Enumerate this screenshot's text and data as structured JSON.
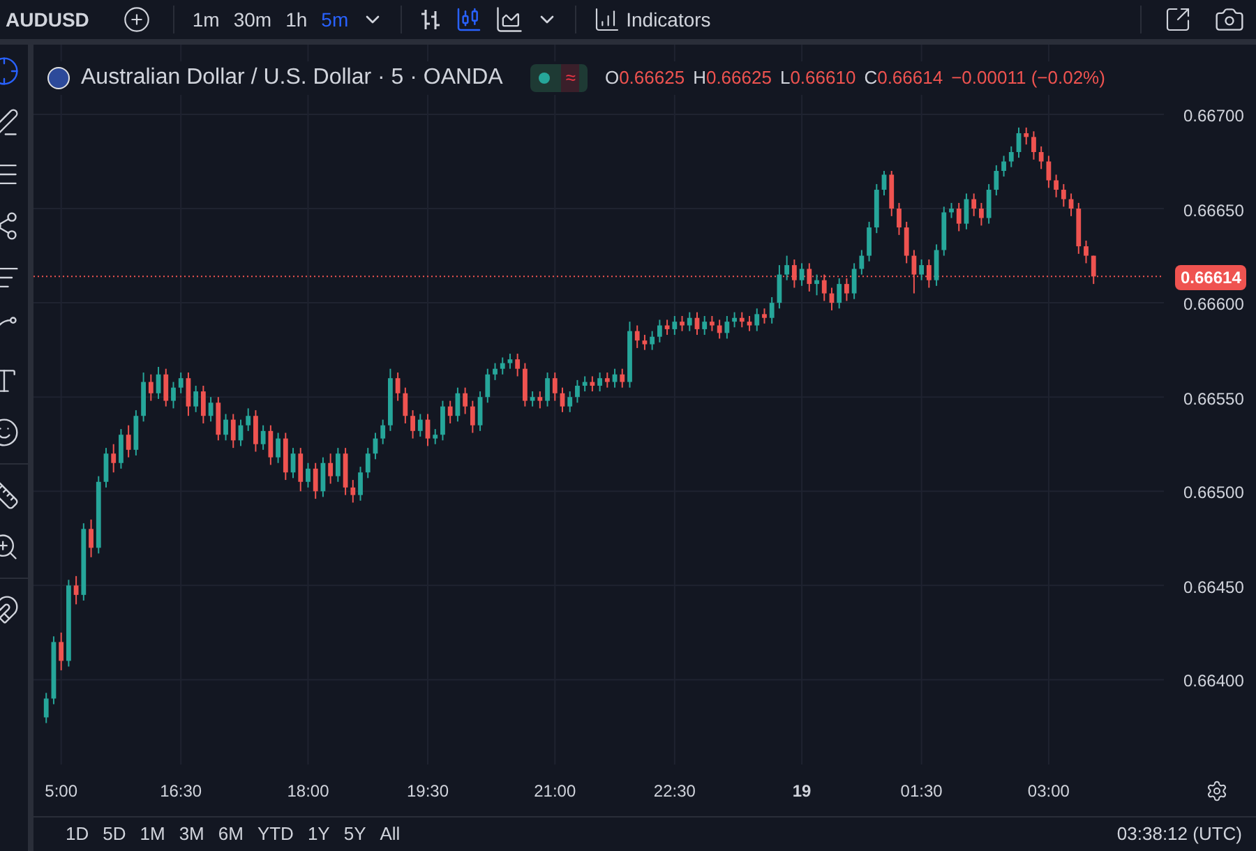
{
  "toolbar": {
    "symbol": "AUDUSD",
    "intervals": [
      {
        "label": "1m",
        "selected": false
      },
      {
        "label": "30m",
        "selected": false
      },
      {
        "label": "1h",
        "selected": false
      },
      {
        "label": "5m",
        "selected": true
      }
    ],
    "indicators": "Indicators"
  },
  "legend": {
    "title": "Australian Dollar / U.S. Dollar · 5 · OANDA",
    "badge": "≈",
    "ohlc": [
      {
        "key": "O",
        "value": "0.66625"
      },
      {
        "key": "H",
        "value": "0.66625"
      },
      {
        "key": "L",
        "value": "0.66610"
      },
      {
        "key": "C",
        "value": "0.66614"
      }
    ],
    "change": "−0.00011 (−0.02%)"
  },
  "chart": {
    "chart_data": {
      "type": "candlestick",
      "categories": [
        null,
        null,
        "5:00",
        null,
        null,
        null,
        null,
        null,
        null,
        null,
        null,
        null,
        null,
        null,
        null,
        null,
        null,
        null,
        "16:30",
        null,
        null,
        null,
        null,
        null,
        null,
        null,
        null,
        null,
        null,
        null,
        null,
        null,
        null,
        null,
        null,
        "18:00",
        null,
        null,
        null,
        null,
        null,
        null,
        null,
        null,
        null,
        null,
        null,
        null,
        null,
        null,
        null,
        "19:30",
        null,
        null,
        null,
        null,
        null,
        null,
        null,
        null,
        null,
        null,
        null,
        null,
        null,
        null,
        null,
        null,
        "21:00",
        null,
        null,
        null,
        null,
        null,
        null,
        null,
        null,
        null,
        null,
        null,
        null,
        null,
        null,
        null,
        "22:30",
        null,
        null,
        null,
        null,
        null,
        null,
        null,
        null,
        null,
        null,
        null,
        null,
        null,
        null,
        null,
        null,
        "19",
        null,
        null,
        null,
        null,
        null,
        null,
        null,
        null,
        null,
        null,
        null,
        null,
        null,
        null,
        null,
        "01:30",
        null,
        null,
        null,
        null,
        null,
        null,
        null,
        null,
        null,
        null,
        null,
        null,
        null,
        null,
        null,
        null,
        "03:00",
        null,
        null,
        null,
        null,
        null,
        null
      ],
      "ylim": [
        0.66355,
        0.66737
      ],
      "grid": true,
      "ref_lines": [
        {
          "axis": "y",
          "value": 0.66614,
          "label": "0.66614",
          "color": "#ef5350"
        }
      ],
      "ohlc": [
        [
          0.6638,
          0.66393,
          0.66377,
          0.6639
        ],
        [
          0.6639,
          0.66423,
          0.66387,
          0.6642
        ],
        [
          0.6642,
          0.66425,
          0.66405,
          0.6641
        ],
        [
          0.6641,
          0.66453,
          0.66407,
          0.6645
        ],
        [
          0.6645,
          0.66455,
          0.6644,
          0.66445
        ],
        [
          0.66445,
          0.66483,
          0.66442,
          0.6648
        ],
        [
          0.6648,
          0.66485,
          0.66465,
          0.6647
        ],
        [
          0.6647,
          0.66508,
          0.66467,
          0.66505
        ],
        [
          0.66505,
          0.66523,
          0.66502,
          0.6652
        ],
        [
          0.6652,
          0.66525,
          0.6651,
          0.66515
        ],
        [
          0.66515,
          0.66533,
          0.66512,
          0.6653
        ],
        [
          0.6653,
          0.66535,
          0.66518,
          0.66522
        ],
        [
          0.66522,
          0.66543,
          0.66519,
          0.6654
        ],
        [
          0.6654,
          0.66563,
          0.66537,
          0.66558
        ],
        [
          0.66558,
          0.66562,
          0.66548,
          0.66552
        ],
        [
          0.66552,
          0.66566,
          0.66549,
          0.66562
        ],
        [
          0.66562,
          0.66565,
          0.66545,
          0.66548
        ],
        [
          0.66548,
          0.66558,
          0.66544,
          0.66555
        ],
        [
          0.66555,
          0.66563,
          0.66552,
          0.6656
        ],
        [
          0.6656,
          0.66563,
          0.6654,
          0.66545
        ],
        [
          0.66545,
          0.66556,
          0.66542,
          0.66553
        ],
        [
          0.66553,
          0.66556,
          0.66536,
          0.6654
        ],
        [
          0.6654,
          0.6655,
          0.66537,
          0.66547
        ],
        [
          0.66547,
          0.6655,
          0.66527,
          0.6653
        ],
        [
          0.6653,
          0.66541,
          0.66527,
          0.66538
        ],
        [
          0.66538,
          0.66541,
          0.66523,
          0.66527
        ],
        [
          0.66527,
          0.66538,
          0.66524,
          0.66535
        ],
        [
          0.66535,
          0.66544,
          0.66532,
          0.6654
        ],
        [
          0.6654,
          0.66543,
          0.66521,
          0.66525
        ],
        [
          0.66525,
          0.66535,
          0.66522,
          0.66532
        ],
        [
          0.66532,
          0.66535,
          0.66514,
          0.66518
        ],
        [
          0.66518,
          0.66531,
          0.66515,
          0.66528
        ],
        [
          0.66528,
          0.66531,
          0.66506,
          0.6651
        ],
        [
          0.6651,
          0.66523,
          0.66507,
          0.6652
        ],
        [
          0.6652,
          0.66523,
          0.665,
          0.66505
        ],
        [
          0.66505,
          0.66515,
          0.66502,
          0.66512
        ],
        [
          0.66512,
          0.66515,
          0.66496,
          0.665
        ],
        [
          0.665,
          0.66518,
          0.66497,
          0.66515
        ],
        [
          0.66515,
          0.6652,
          0.66504,
          0.66508
        ],
        [
          0.66508,
          0.66523,
          0.66505,
          0.6652
        ],
        [
          0.6652,
          0.66523,
          0.66498,
          0.66502
        ],
        [
          0.66502,
          0.66506,
          0.66494,
          0.66498
        ],
        [
          0.66498,
          0.66513,
          0.66495,
          0.6651
        ],
        [
          0.6651,
          0.66523,
          0.66507,
          0.6652
        ],
        [
          0.6652,
          0.66531,
          0.66517,
          0.66528
        ],
        [
          0.66528,
          0.66538,
          0.66525,
          0.66535
        ],
        [
          0.66535,
          0.66565,
          0.66532,
          0.6656
        ],
        [
          0.6656,
          0.66563,
          0.66548,
          0.66552
        ],
        [
          0.66552,
          0.66555,
          0.66536,
          0.6654
        ],
        [
          0.6654,
          0.66543,
          0.66528,
          0.66532
        ],
        [
          0.66532,
          0.66541,
          0.66529,
          0.66538
        ],
        [
          0.66538,
          0.66541,
          0.66524,
          0.66528
        ],
        [
          0.66528,
          0.66533,
          0.66525,
          0.6653
        ],
        [
          0.6653,
          0.66548,
          0.66527,
          0.66545
        ],
        [
          0.66545,
          0.66548,
          0.66536,
          0.6654
        ],
        [
          0.6654,
          0.66555,
          0.66537,
          0.66552
        ],
        [
          0.66552,
          0.66555,
          0.66541,
          0.66545
        ],
        [
          0.66545,
          0.66548,
          0.66531,
          0.66535
        ],
        [
          0.66535,
          0.66553,
          0.66532,
          0.6655
        ],
        [
          0.6655,
          0.66565,
          0.66547,
          0.66562
        ],
        [
          0.66562,
          0.66568,
          0.66559,
          0.66565
        ],
        [
          0.66565,
          0.66571,
          0.66562,
          0.66568
        ],
        [
          0.66568,
          0.66573,
          0.66565,
          0.6657
        ],
        [
          0.6657,
          0.66573,
          0.66561,
          0.66565
        ],
        [
          0.66565,
          0.66568,
          0.66545,
          0.66548
        ],
        [
          0.66548,
          0.66553,
          0.66545,
          0.6655
        ],
        [
          0.6655,
          0.66553,
          0.66544,
          0.66548
        ],
        [
          0.66548,
          0.66563,
          0.66545,
          0.6656
        ],
        [
          0.6656,
          0.66563,
          0.66548,
          0.66552
        ],
        [
          0.66552,
          0.66555,
          0.66542,
          0.66545
        ],
        [
          0.66545,
          0.66553,
          0.66542,
          0.6655
        ],
        [
          0.6655,
          0.66559,
          0.66547,
          0.66556
        ],
        [
          0.66556,
          0.66561,
          0.66553,
          0.66558
        ],
        [
          0.66558,
          0.66561,
          0.66553,
          0.66556
        ],
        [
          0.66556,
          0.66563,
          0.66553,
          0.6656
        ],
        [
          0.6656,
          0.66563,
          0.66555,
          0.66558
        ],
        [
          0.66558,
          0.66565,
          0.66555,
          0.66562
        ],
        [
          0.66562,
          0.66565,
          0.66555,
          0.66558
        ],
        [
          0.66558,
          0.6659,
          0.66555,
          0.66585
        ],
        [
          0.66585,
          0.66588,
          0.66576,
          0.6658
        ],
        [
          0.6658,
          0.66583,
          0.66575,
          0.66578
        ],
        [
          0.66578,
          0.66585,
          0.66575,
          0.66582
        ],
        [
          0.66582,
          0.66591,
          0.66579,
          0.66588
        ],
        [
          0.66588,
          0.66591,
          0.66583,
          0.66586
        ],
        [
          0.66586,
          0.66593,
          0.66583,
          0.6659
        ],
        [
          0.6659,
          0.66593,
          0.66585,
          0.66588
        ],
        [
          0.66588,
          0.66595,
          0.66585,
          0.66592
        ],
        [
          0.66592,
          0.66595,
          0.66583,
          0.66586
        ],
        [
          0.66586,
          0.66593,
          0.66583,
          0.6659
        ],
        [
          0.6659,
          0.66593,
          0.66585,
          0.66588
        ],
        [
          0.66588,
          0.66591,
          0.66581,
          0.66584
        ],
        [
          0.66584,
          0.66593,
          0.66581,
          0.6659
        ],
        [
          0.6659,
          0.66595,
          0.66587,
          0.66592
        ],
        [
          0.66592,
          0.66595,
          0.66587,
          0.6659
        ],
        [
          0.6659,
          0.66593,
          0.66585,
          0.66588
        ],
        [
          0.66588,
          0.66597,
          0.66585,
          0.66594
        ],
        [
          0.66594,
          0.66597,
          0.66589,
          0.66592
        ],
        [
          0.66592,
          0.66603,
          0.66589,
          0.666
        ],
        [
          0.666,
          0.6662,
          0.66597,
          0.66615
        ],
        [
          0.66615,
          0.66625,
          0.66612,
          0.6662
        ],
        [
          0.6662,
          0.66623,
          0.66608,
          0.66612
        ],
        [
          0.66612,
          0.66621,
          0.66609,
          0.66618
        ],
        [
          0.66618,
          0.66621,
          0.66606,
          0.6661
        ],
        [
          0.6661,
          0.66615,
          0.66604,
          0.66612
        ],
        [
          0.66612,
          0.66615,
          0.66601,
          0.66605
        ],
        [
          0.66605,
          0.66608,
          0.66596,
          0.666
        ],
        [
          0.666,
          0.66613,
          0.66597,
          0.6661
        ],
        [
          0.6661,
          0.66613,
          0.66601,
          0.66605
        ],
        [
          0.66605,
          0.66621,
          0.66602,
          0.66618
        ],
        [
          0.66618,
          0.66628,
          0.66615,
          0.66625
        ],
        [
          0.66625,
          0.66643,
          0.66622,
          0.6664
        ],
        [
          0.6664,
          0.66663,
          0.66637,
          0.6666
        ],
        [
          0.6666,
          0.6667,
          0.66657,
          0.66668
        ],
        [
          0.66668,
          0.6667,
          0.66646,
          0.6665
        ],
        [
          0.6665,
          0.66653,
          0.66636,
          0.6664
        ],
        [
          0.6664,
          0.66643,
          0.66621,
          0.66625
        ],
        [
          0.66625,
          0.66628,
          0.66605,
          0.66615
        ],
        [
          0.66615,
          0.66623,
          0.66612,
          0.6662
        ],
        [
          0.6662,
          0.66623,
          0.66608,
          0.66612
        ],
        [
          0.66612,
          0.66631,
          0.66609,
          0.66628
        ],
        [
          0.66628,
          0.66651,
          0.66625,
          0.66648
        ],
        [
          0.66648,
          0.66653,
          0.66645,
          0.6665
        ],
        [
          0.6665,
          0.66653,
          0.66638,
          0.66642
        ],
        [
          0.66642,
          0.66658,
          0.66639,
          0.66655
        ],
        [
          0.66655,
          0.66658,
          0.66646,
          0.6665
        ],
        [
          0.6665,
          0.66653,
          0.66641,
          0.66645
        ],
        [
          0.66645,
          0.66663,
          0.66642,
          0.6666
        ],
        [
          0.6666,
          0.66673,
          0.66657,
          0.6667
        ],
        [
          0.6667,
          0.66678,
          0.66667,
          0.66675
        ],
        [
          0.66675,
          0.66683,
          0.66672,
          0.6668
        ],
        [
          0.6668,
          0.66693,
          0.66677,
          0.6669
        ],
        [
          0.6669,
          0.66693,
          0.66684,
          0.66688
        ],
        [
          0.66688,
          0.66691,
          0.66676,
          0.6668
        ],
        [
          0.6668,
          0.66683,
          0.66671,
          0.66675
        ],
        [
          0.66675,
          0.66678,
          0.66661,
          0.66665
        ],
        [
          0.66665,
          0.66668,
          0.66656,
          0.6666
        ],
        [
          0.6666,
          0.66663,
          0.66651,
          0.66655
        ],
        [
          0.66655,
          0.66658,
          0.66646,
          0.6665
        ],
        [
          0.6665,
          0.66653,
          0.66626,
          0.6663
        ],
        [
          0.6663,
          0.66633,
          0.66621,
          0.66625
        ],
        [
          0.66625,
          0.66625,
          0.6661,
          0.66614
        ]
      ],
      "yticks": [
        {
          "value": 0.667,
          "label": "0.66700"
        },
        {
          "value": 0.6665,
          "label": "0.66650"
        },
        {
          "value": 0.666,
          "label": "0.66600"
        },
        {
          "value": 0.6655,
          "label": "0.66550"
        },
        {
          "value": 0.665,
          "label": "0.66500"
        },
        {
          "value": 0.6645,
          "label": "0.66450"
        },
        {
          "value": 0.664,
          "label": "0.66400"
        }
      ]
    }
  },
  "time_axis": {
    "label_bold": [
      false,
      false,
      false,
      false,
      false,
      false,
      true,
      false,
      false
    ]
  },
  "ranges": [
    "1D",
    "5D",
    "1M",
    "3M",
    "6M",
    "YTD",
    "1Y",
    "5Y",
    "All"
  ],
  "clock": "03:38:12 (UTC)"
}
